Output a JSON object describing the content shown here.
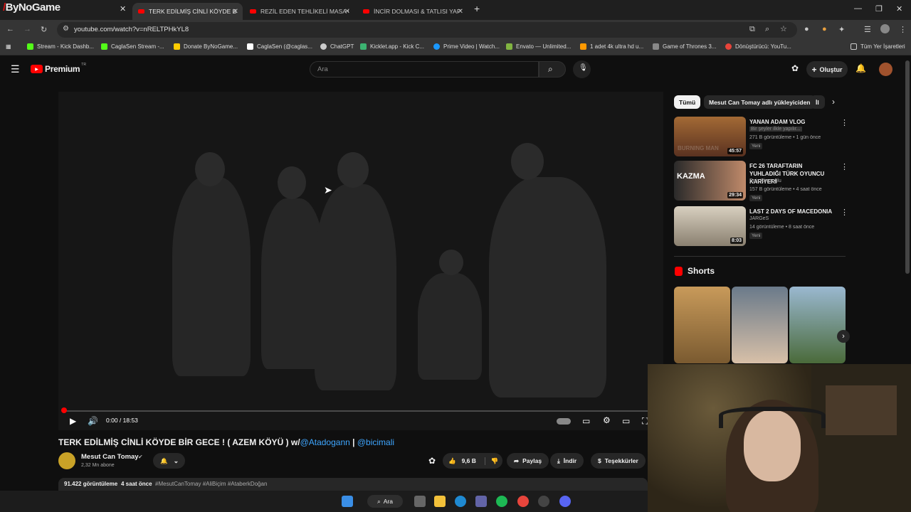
{
  "browser": {
    "overlay_logo_text": "ByNoGame",
    "tabs": [
      {
        "title": "TERK EDİLMİŞ CİNLİ KÖYDE BİR",
        "active": true
      },
      {
        "title": "REZİL EDEN TEHLİKELİ MASA O",
        "active": false
      },
      {
        "title": "İNCİR DOLMASI & TATLISI YAPT",
        "active": false
      }
    ],
    "url": "youtube.com/watch?v=nRELTPHkYL8",
    "bookmarks": [
      {
        "label": "Stream - Kick Dashb...",
        "color": "#53fc18"
      },
      {
        "label": "CaglaSen Stream -...",
        "color": "#53fc18"
      },
      {
        "label": "Donate ByNoGame...",
        "color": "#ffcc00"
      },
      {
        "label": "CaglaSen (@caglas...",
        "color": "#ffffff"
      },
      {
        "label": "ChatGPT",
        "color": "#cccccc"
      },
      {
        "label": "Kicklet.app - Kick C...",
        "color": "#3cb371"
      },
      {
        "label": "Prime Video | Watch...",
        "color": "#1a98ff"
      },
      {
        "label": "Envato — Unlimited...",
        "color": "#81b441"
      },
      {
        "label": "1 adet 4k ultra hd u...",
        "color": "#ff9900"
      },
      {
        "label": "Game of Thrones 3...",
        "color": "#888888"
      },
      {
        "label": "Dönüştürücü: YouTu...",
        "color": "#e8443a"
      }
    ],
    "all_bookmarks": "Tüm Yer İşaretleri"
  },
  "youtube": {
    "logo_text": "Premium",
    "logo_sup": "TR",
    "search_placeholder": "Ara",
    "create_label": "Oluştur",
    "player": {
      "time": "0:00 / 18:53",
      "progress_fraction": 0.0
    },
    "video": {
      "title_main": "TERK EDİLMİŞ CİNLİ KÖYDE BİR GECE ! ( AZEM KÖYÜ ) w/",
      "mention1": "@Atadogann",
      "separator": " | ",
      "mention2": "@bicimali",
      "channel": "Mesut Can Tomay",
      "subscribers": "2,32 Mn abone",
      "likes": "9,6 B",
      "share_label": "Paylaş",
      "download_label": "İndir",
      "thanks_label": "Teşekkürler",
      "views": "91.422 görüntüleme",
      "age": "4 saat önce",
      "hashtags": "#MesutCanTomay #AliBiçim #AtaberkDoğan"
    },
    "chips": [
      "Tümü",
      "Mesut Can Tomay adlı yükleyiciden",
      "İl"
    ],
    "recommendations": [
      {
        "title": "YANAN ADAM VLOG",
        "channel": "Bir şeyler ilkle yapılır...",
        "stats": "271 B görüntüleme • 1 gün önce",
        "badge": "Yeni",
        "duration": "45:57"
      },
      {
        "title": "FC 26 TARAFTARIN YUHLADIĞI TÜRK OYUNCU KARİYERİ",
        "channel": "Enis Kirazoglu",
        "stats": "157 B görüntüleme • 4 saat önce",
        "badge": "Yeni",
        "duration": "29:34"
      },
      {
        "title": "LAST 2 DAYS OF MACEDONIA",
        "channel": "JARGeS",
        "stats": "14 görüntüleme • 8 saat önce",
        "badge": "Yeni",
        "duration": "8:03"
      }
    ],
    "thumb_text": {
      "rec1": "BURNING MAN",
      "rec2": "KAZMA"
    },
    "shorts_label": "Shorts"
  },
  "taskbar": {
    "search_label": "Ara"
  }
}
